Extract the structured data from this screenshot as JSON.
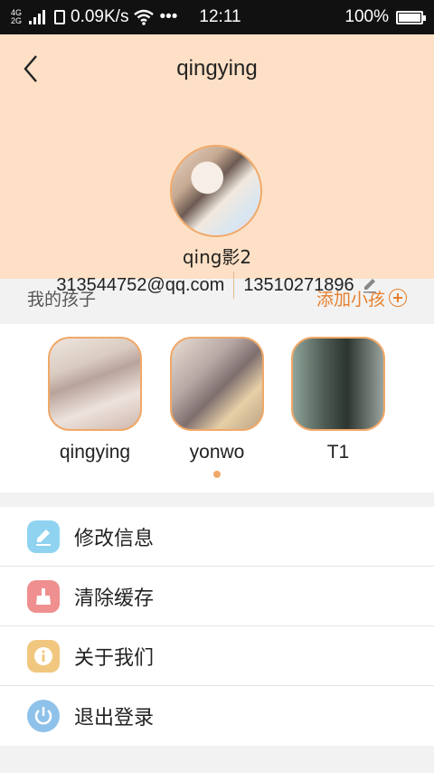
{
  "status_bar": {
    "network_top": "4G",
    "network_bottom": "2G",
    "speed": "0.09K/s",
    "dots": "•••",
    "time": "12:11",
    "battery": "100%"
  },
  "header": {
    "title": "qingying",
    "username": "qing影2",
    "email": "313544752@qq.com",
    "phone": "13510271896",
    "accent_color": "#fde0c5"
  },
  "kids_section": {
    "label": "我的孩子",
    "add_label": "添加小孩",
    "add_color": "#e87f2b",
    "kids": [
      {
        "name": "qingying"
      },
      {
        "name": "yonwo",
        "selected": true
      },
      {
        "name": "T1"
      }
    ]
  },
  "menu": {
    "items": [
      {
        "label": "修改信息",
        "icon": "edit-icon",
        "color": "#8fd3f1"
      },
      {
        "label": "清除缓存",
        "icon": "broom-icon",
        "color": "#ef8f8f"
      },
      {
        "label": "关于我们",
        "icon": "info-icon",
        "color": "#f1c77f"
      },
      {
        "label": "退出登录",
        "icon": "power-icon",
        "color": "#8fc2ea"
      }
    ]
  }
}
